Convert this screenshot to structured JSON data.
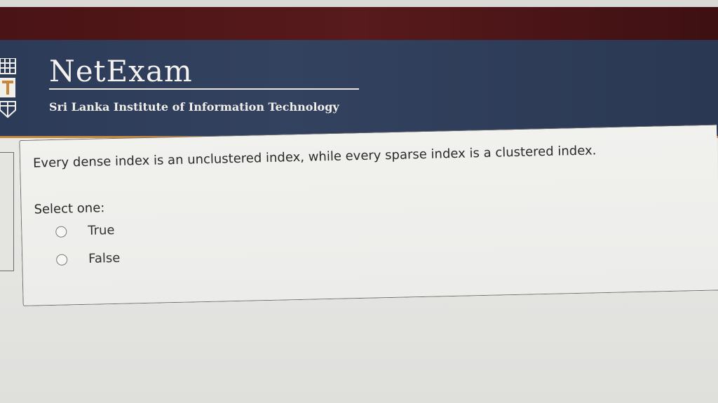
{
  "header": {
    "title": "NetExam",
    "subtitle": "Sri Lanka Institute of Information Technology"
  },
  "question": {
    "text": "Every dense index is an unclustered index, while every sparse index is a clustered index.",
    "prompt": "Select one:",
    "options": [
      {
        "label": "True",
        "selected": false
      },
      {
        "label": "False",
        "selected": false
      }
    ]
  },
  "colors": {
    "header_bg": "#2c3b58",
    "top_bar": "#4a1315",
    "accent_line": "#c9873e"
  }
}
